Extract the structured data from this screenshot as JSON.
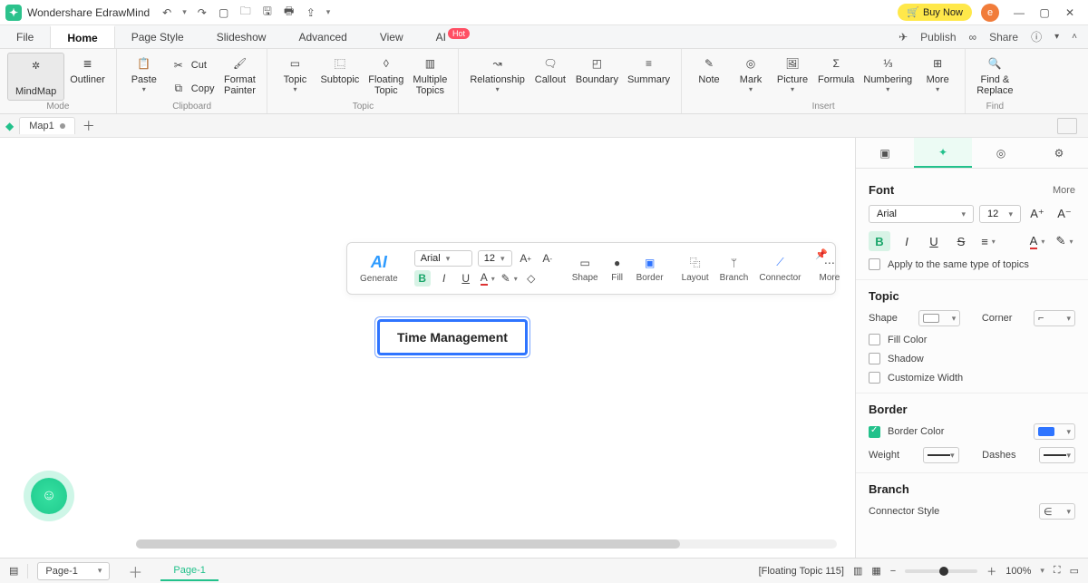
{
  "titlebar": {
    "appname": "Wondershare EdrawMind",
    "buynow": "Buy Now",
    "avatar_letter": "e"
  },
  "menubar": {
    "tabs": [
      "File",
      "Home",
      "Page Style",
      "Slideshow",
      "Advanced",
      "View",
      "AI"
    ],
    "hot": "Hot",
    "publish": "Publish",
    "share": "Share"
  },
  "ribbon": {
    "mode": {
      "label": "Mode",
      "mindmap": "MindMap",
      "outliner": "Outliner"
    },
    "clipboard": {
      "label": "Clipboard",
      "paste": "Paste",
      "cut": "Cut",
      "copy": "Copy",
      "format_painter": "Format\nPainter"
    },
    "topic": {
      "label": "Topic",
      "topic": "Topic",
      "subtopic": "Subtopic",
      "floating": "Floating\nTopic",
      "multiple": "Multiple\nTopics"
    },
    "insert_left": {
      "relationship": "Relationship",
      "callout": "Callout",
      "boundary": "Boundary",
      "summary": "Summary"
    },
    "insert": {
      "label": "Insert",
      "note": "Note",
      "mark": "Mark",
      "picture": "Picture",
      "formula": "Formula",
      "numbering": "Numbering",
      "more": "More"
    },
    "find": {
      "label": "Find",
      "find_replace": "Find &\nReplace"
    }
  },
  "doctab": {
    "name": "Map1"
  },
  "canvas": {
    "topic_text": "Time Management"
  },
  "floatbar": {
    "generate": "Generate",
    "font": "Arial",
    "size": "12",
    "shape": "Shape",
    "fill": "Fill",
    "border": "Border",
    "layout": "Layout",
    "branch": "Branch",
    "connector": "Connector",
    "more": "More"
  },
  "sidepanel": {
    "font_h": "Font",
    "more": "More",
    "font": "Arial",
    "size": "12",
    "apply_same": "Apply to the same type of topics",
    "topic_h": "Topic",
    "shape": "Shape",
    "corner": "Corner",
    "fill_color": "Fill Color",
    "shadow": "Shadow",
    "custom_width": "Customize Width",
    "border_h": "Border",
    "border_color": "Border Color",
    "weight": "Weight",
    "dashes": "Dashes",
    "branch_h": "Branch",
    "connector_style": "Connector Style"
  },
  "statusbar": {
    "page_sel": "Page-1",
    "page_tab": "Page-1",
    "floating": "[Floating Topic 115]",
    "zoom": "100%"
  }
}
